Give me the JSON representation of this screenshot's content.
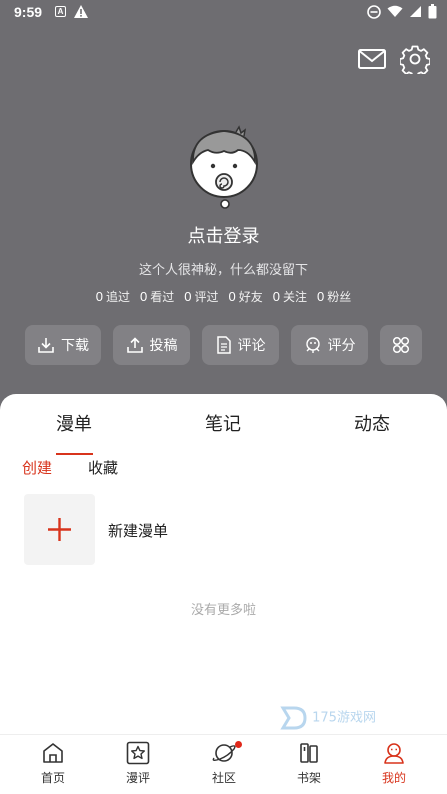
{
  "status": {
    "time": "9:59",
    "notif_letter": "A"
  },
  "header": {
    "login": "点击登录",
    "bio": "这个人很神秘，什么都没留下",
    "stats": [
      {
        "num": "0",
        "label": "追过"
      },
      {
        "num": "0",
        "label": "看过"
      },
      {
        "num": "0",
        "label": "评过"
      },
      {
        "num": "0",
        "label": "好友"
      },
      {
        "num": "0",
        "label": "关注"
      },
      {
        "num": "0",
        "label": "粉丝"
      }
    ],
    "actions": [
      {
        "label": "下载",
        "icon": "download-icon"
      },
      {
        "label": "投稿",
        "icon": "upload-icon"
      },
      {
        "label": "评论",
        "icon": "document-icon"
      },
      {
        "label": "评分",
        "icon": "rating-icon"
      },
      {
        "label": "",
        "icon": "grid-icon"
      }
    ]
  },
  "tabs": [
    "漫单",
    "笔记",
    "动态"
  ],
  "subtabs": [
    "创建",
    "收藏"
  ],
  "new_list_label": "新建漫单",
  "no_more": "没有更多啦",
  "watermark": "175游戏网",
  "nav": [
    {
      "label": "首页",
      "icon": "home-icon"
    },
    {
      "label": "漫评",
      "icon": "star-review-icon"
    },
    {
      "label": "社区",
      "icon": "planet-icon"
    },
    {
      "label": "书架",
      "icon": "bookshelf-icon"
    },
    {
      "label": "我的",
      "icon": "profile-icon"
    }
  ],
  "colors": {
    "accent": "#d8341c",
    "header_bg": "#6e6d71"
  }
}
